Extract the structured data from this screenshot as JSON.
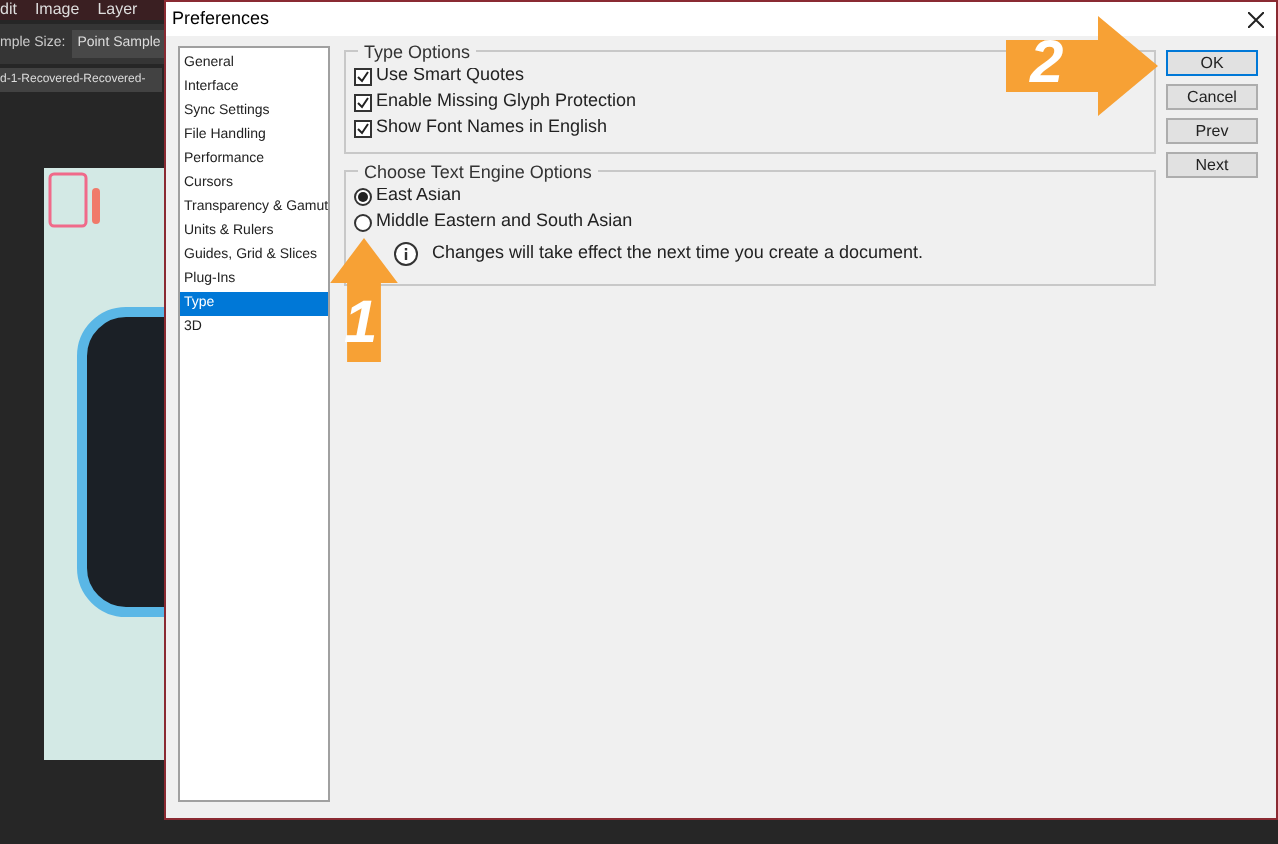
{
  "app": {
    "menu": [
      "dit",
      "Image",
      "Layer"
    ],
    "options_bar": {
      "label": "mple Size:",
      "value": "Point Sample"
    },
    "document_tab": "d-1-Recovered-Recovered-"
  },
  "dialog": {
    "title": "Preferences",
    "categories": [
      {
        "label": "General",
        "selected": false
      },
      {
        "label": "Interface",
        "selected": false
      },
      {
        "label": "Sync Settings",
        "selected": false
      },
      {
        "label": "File Handling",
        "selected": false
      },
      {
        "label": "Performance",
        "selected": false
      },
      {
        "label": "Cursors",
        "selected": false
      },
      {
        "label": "Transparency & Gamut",
        "selected": false
      },
      {
        "label": "Units & Rulers",
        "selected": false
      },
      {
        "label": "Guides, Grid & Slices",
        "selected": false
      },
      {
        "label": "Plug-Ins",
        "selected": false
      },
      {
        "label": "Type",
        "selected": true
      },
      {
        "label": "3D",
        "selected": false
      }
    ],
    "type_options": {
      "title": "Type Options",
      "checkboxes": [
        {
          "label": "Use Smart Quotes",
          "checked": true
        },
        {
          "label": "Enable Missing Glyph Protection",
          "checked": true
        },
        {
          "label": "Show Font Names in English",
          "checked": true
        }
      ]
    },
    "text_engine": {
      "title": "Choose Text Engine Options",
      "radios": [
        {
          "label": "East Asian",
          "selected": true
        },
        {
          "label": "Middle Eastern and South Asian",
          "selected": false
        }
      ],
      "note": "Changes will take effect the next time you create a document."
    },
    "buttons": [
      {
        "label": "OK",
        "default": true
      },
      {
        "label": "Cancel",
        "default": false
      },
      {
        "label": "Prev",
        "default": false
      },
      {
        "label": "Next",
        "default": false
      }
    ]
  },
  "annotations": [
    {
      "label": "1"
    },
    {
      "label": "2"
    }
  ]
}
